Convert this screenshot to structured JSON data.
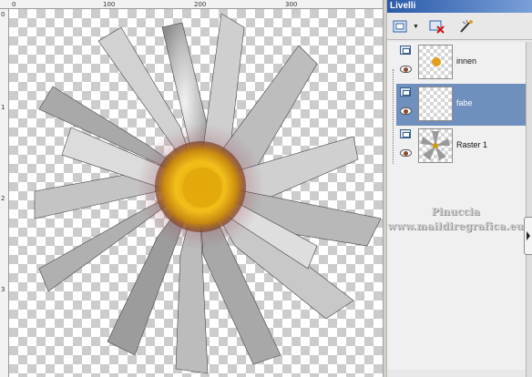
{
  "palette": {
    "title": "Livelli",
    "toolbar": {
      "new_raster_icon": "new-raster-layer-icon",
      "delete_icon": "delete-layer-icon",
      "mask_icon": "edit-mask-icon"
    },
    "layers": [
      {
        "name": "innen",
        "selected": false
      },
      {
        "name": "fabe",
        "selected": true
      },
      {
        "name": "Raster 1",
        "selected": false
      }
    ],
    "watermark": {
      "line1": "Pinuccia",
      "line2": "www.maildiregrafica.eu"
    }
  },
  "rulers": {
    "top_labels": [
      "0",
      "100",
      "200",
      "300"
    ],
    "left_labels": [
      "0",
      "1",
      "2",
      "3"
    ]
  },
  "colors": {
    "title_bar": "#2a5aa8",
    "selected_row": "#6f8fbd",
    "flower_center": "#f0b416"
  }
}
